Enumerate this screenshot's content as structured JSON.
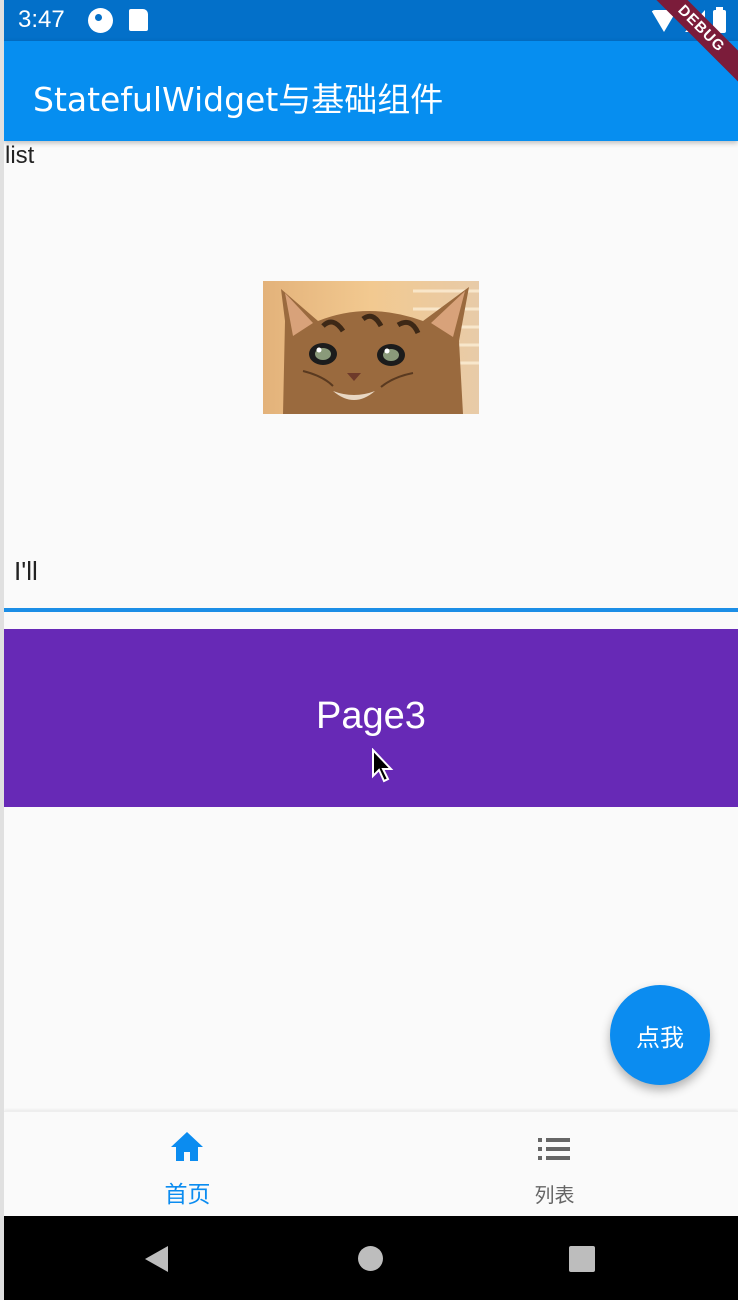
{
  "status_bar": {
    "time": "3:47",
    "icons": [
      "t-icon",
      "sd-card-icon",
      "wifi-icon",
      "signal-icon",
      "battery-icon"
    ]
  },
  "debug_banner": "DEBUG",
  "app_bar": {
    "title": "StatefulWidget与基础组件"
  },
  "body": {
    "list_label": "list",
    "text_field_value": "I'll",
    "page_label": "Page3"
  },
  "fab": {
    "label": "点我"
  },
  "bottom_nav": {
    "items": [
      {
        "label": "首页",
        "icon": "home-icon",
        "active": true
      },
      {
        "label": "列表",
        "icon": "list-icon",
        "active": false
      }
    ]
  },
  "colors": {
    "status_bar": "#0370c9",
    "app_bar": "#068ef0",
    "accent": "#0b8cf0",
    "page_panel": "#6729b6",
    "background": "#fafafa"
  }
}
